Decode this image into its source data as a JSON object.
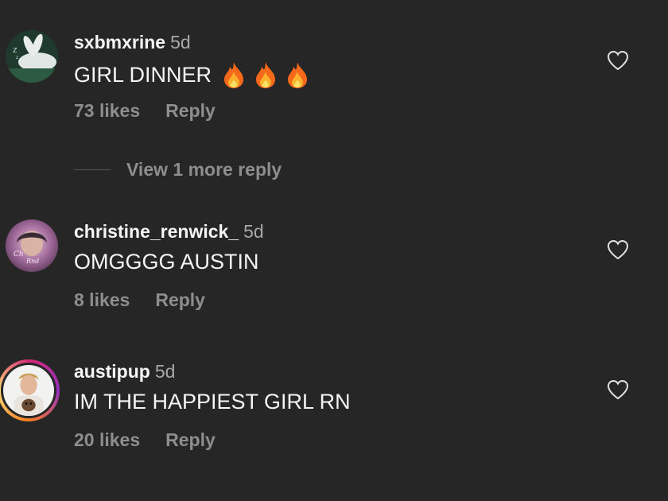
{
  "comments": [
    {
      "username": "sxbmxrine",
      "time": "5d",
      "text": "GIRL DINNER",
      "emoji": "fire",
      "likes": "73 likes",
      "reply": "Reply"
    },
    {
      "username": "christine_renwick_",
      "time": "5d",
      "text": "OMGGGG AUSTIN",
      "likes": "8 likes",
      "reply": "Reply"
    },
    {
      "username": "austipup",
      "time": "5d",
      "text": "IM THE HAPPIEST GIRL RN",
      "likes": "20 likes",
      "reply": "Reply"
    }
  ],
  "view_more": "View 1 more reply"
}
